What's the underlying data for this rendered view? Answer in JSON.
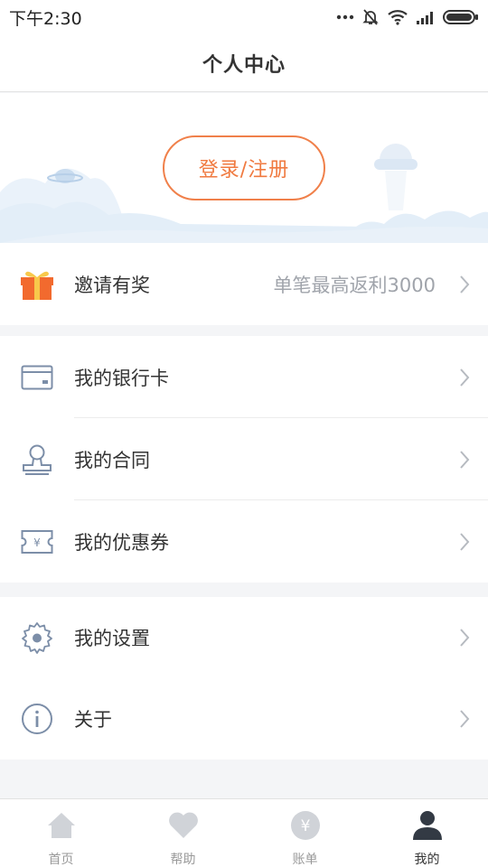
{
  "status_bar": {
    "time": "下午2:30"
  },
  "header": {
    "title": "个人中心"
  },
  "banner": {
    "login_label": "登录/注册"
  },
  "invite": {
    "label": "邀请有奖",
    "subtitle": "单笔最高返利3000"
  },
  "menu_group_1": [
    {
      "label": "我的银行卡",
      "icon": "bank-card-icon"
    },
    {
      "label": "我的合同",
      "icon": "stamp-icon"
    },
    {
      "label": "我的优惠券",
      "icon": "coupon-icon"
    }
  ],
  "menu_group_2": [
    {
      "label": "我的设置",
      "icon": "gear-icon"
    },
    {
      "label": "关于",
      "icon": "info-icon"
    }
  ],
  "tabbar": {
    "tabs": [
      {
        "label": "首页",
        "icon": "home-icon",
        "active": false
      },
      {
        "label": "帮助",
        "icon": "heart-icon",
        "active": false
      },
      {
        "label": "账单",
        "icon": "yen-icon",
        "active": false
      },
      {
        "label": "我的",
        "icon": "person-icon",
        "active": true
      }
    ]
  },
  "colors": {
    "accent": "#f07a40",
    "icon_gray": "#7c8ea8",
    "active_tab": "#333333"
  }
}
